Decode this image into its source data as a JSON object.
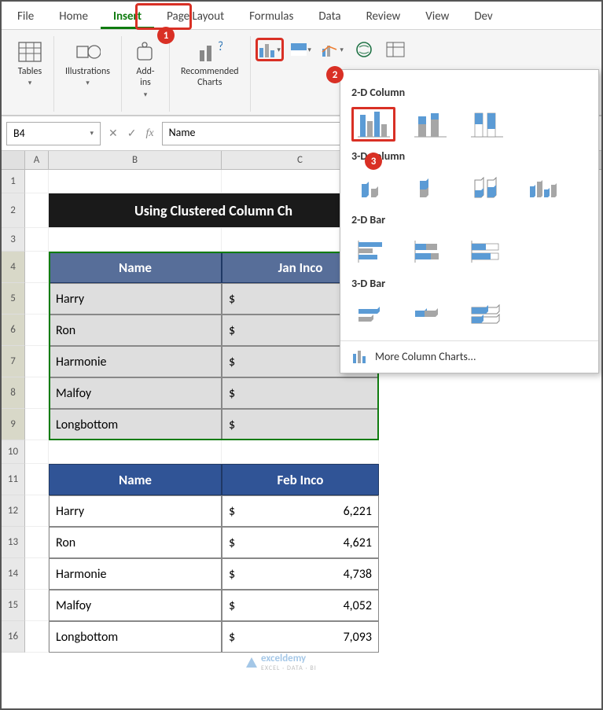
{
  "tabs": [
    "File",
    "Home",
    "Insert",
    "Page Layout",
    "Formulas",
    "Data",
    "Review",
    "View",
    "Dev"
  ],
  "active_tab": "Insert",
  "ribbon": {
    "tables": "Tables",
    "illustrations": "Illustrations",
    "addins": "Add-\nins",
    "recommended": "Recommended\nCharts"
  },
  "namebox": "B4",
  "formula": "Name",
  "col_headers": [
    "A",
    "B",
    "C"
  ],
  "title": "Using Clustered Column Ch",
  "table1": {
    "h1": "Name",
    "h2": "Jan Inco",
    "rows": [
      {
        "name": "Harry",
        "sym": "$"
      },
      {
        "name": "Ron",
        "sym": "$"
      },
      {
        "name": "Harmonie",
        "sym": "$"
      },
      {
        "name": "Malfoy",
        "sym": "$"
      },
      {
        "name": "Longbottom",
        "sym": "$"
      }
    ]
  },
  "table2": {
    "h1": "Name",
    "h2": "Feb Inco",
    "rows": [
      {
        "name": "Harry",
        "sym": "$",
        "val": "6,221"
      },
      {
        "name": "Ron",
        "sym": "$",
        "val": "4,621"
      },
      {
        "name": "Harmonie",
        "sym": "$",
        "val": "4,738"
      },
      {
        "name": "Malfoy",
        "sym": "$",
        "val": "4,052"
      },
      {
        "name": "Longbottom",
        "sym": "$",
        "val": "7,093"
      }
    ]
  },
  "dropdown": {
    "s1": "2-D Column",
    "s2": "3-D Column",
    "s3": "2-D Bar",
    "s4": "3-D Bar",
    "more": "More Column Charts..."
  },
  "badges": {
    "b1": "1",
    "b2": "2",
    "b3": "3"
  },
  "watermark": {
    "brand": "exceldemy",
    "tag": "EXCEL · DATA · BI"
  }
}
